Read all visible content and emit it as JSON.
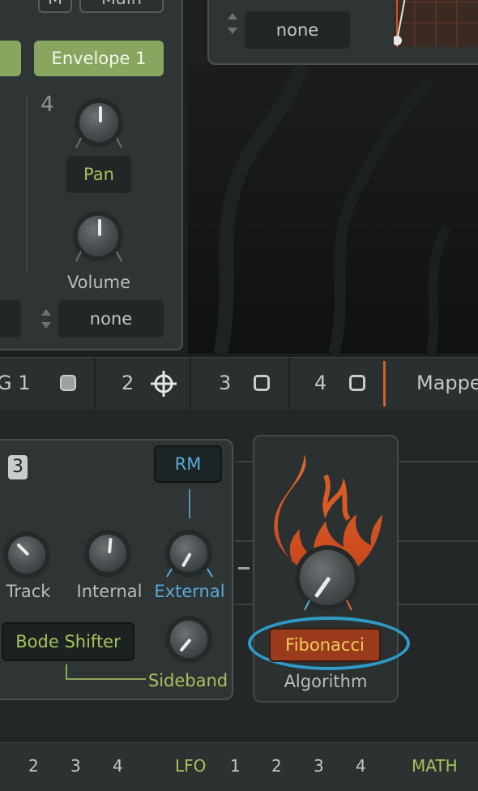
{
  "voice_panel": {
    "m_button": "M",
    "main_button": "Main",
    "envelope_button": "Envelope 1",
    "slot_number": "4",
    "pan_label": "Pan",
    "volume_label": "Volume",
    "modulation_value": "none"
  },
  "env_panel": {
    "dropdown_value": "none"
  },
  "tabs": {
    "eg1": "G 1",
    "tab2": "2",
    "tab3": "3",
    "tab4": "4",
    "mapper": "Mappe"
  },
  "osc": {
    "number": "3",
    "rm_button": "RM",
    "track_label": "Track",
    "internal_label": "Internal",
    "external_label": "External",
    "mode_button": "Bode Shifter",
    "sideband_label": "Sideband"
  },
  "algorithm": {
    "value": "Fibonacci",
    "label": "Algorithm"
  },
  "bottom_bar": {
    "env_nums": [
      "2",
      "3",
      "4"
    ],
    "lfo_label": "LFO",
    "lfo_nums": [
      "1",
      "2",
      "3",
      "4"
    ],
    "math_label": "MATH"
  },
  "colors": {
    "accent_green": "#88a65f",
    "label_green": "#a8c25b",
    "accent_blue": "#5aa9d6",
    "accent_orange": "#e0642a",
    "highlight_ring": "#2f9ac7"
  }
}
